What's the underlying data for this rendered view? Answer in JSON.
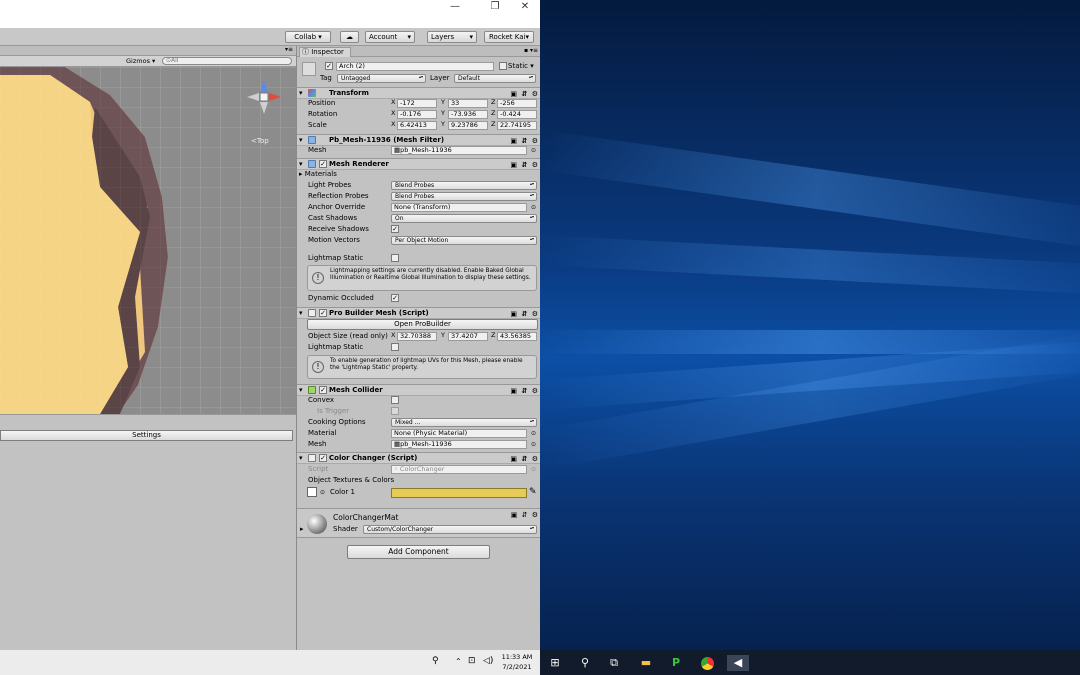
{
  "window": {
    "minimize": "—",
    "restore": "❐",
    "close": "✕"
  },
  "toolbar": {
    "collab": "Collab ▾",
    "cloud": "☁",
    "account": "Account",
    "layers": "Layers",
    "rocket": "Rocket Kai▾"
  },
  "scene": {
    "gizmos": "Gizmos ▾",
    "search_placeholder": "All",
    "orientation": "Top",
    "settings_btn": "Settings"
  },
  "inspector": {
    "tab": "Inspector",
    "object_name": "Arch (2)",
    "static_label": "Static",
    "tag_label": "Tag",
    "tag_value": "Untagged",
    "layer_label": "Layer",
    "layer_value": "Default",
    "transform": {
      "title": "Transform",
      "position": {
        "label": "Position",
        "x": "-172",
        "y": "33",
        "z": "-256"
      },
      "rotation": {
        "label": "Rotation",
        "x": "-0.176",
        "y": "-73.936",
        "z": "-0.424"
      },
      "scale": {
        "label": "Scale",
        "x": "6.42413",
        "y": "9.23786",
        "z": "22.74195"
      }
    },
    "mesh_filter": {
      "title": "Pb_Mesh-11936 (Mesh Filter)",
      "mesh_label": "Mesh",
      "mesh_value": "pb_Mesh-11936"
    },
    "mesh_renderer": {
      "title": "Mesh Renderer",
      "materials": "Materials",
      "light_probes": {
        "label": "Light Probes",
        "value": "Blend Probes"
      },
      "reflection_probes": {
        "label": "Reflection Probes",
        "value": "Blend Probes"
      },
      "anchor_override": {
        "label": "Anchor Override",
        "value": "None (Transform)"
      },
      "cast_shadows": {
        "label": "Cast Shadows",
        "value": "On"
      },
      "receive_shadows": {
        "label": "Receive Shadows"
      },
      "motion_vectors": {
        "label": "Motion Vectors",
        "value": "Per Object Motion"
      },
      "lightmap_static": {
        "label": "Lightmap Static"
      },
      "help": "Lightmapping settings are currently disabled. Enable Baked Global Illumination or Realtime Global Illumination to display these settings.",
      "dynamic_occluded": {
        "label": "Dynamic Occluded"
      }
    },
    "probuilder": {
      "title": "Pro Builder Mesh (Script)",
      "open_btn": "Open ProBuilder",
      "object_size": {
        "label": "Object Size (read only)",
        "x": "32.70388",
        "y": "37.4207",
        "z": "43.56385"
      },
      "lightmap_static": "Lightmap Static",
      "help": "To enable generation of lightmap UVs for this Mesh, please enable the 'Lightmap Static' property."
    },
    "mesh_collider": {
      "title": "Mesh Collider",
      "convex": "Convex",
      "is_trigger": "Is Trigger",
      "cooking": {
        "label": "Cooking Options",
        "value": "Mixed ..."
      },
      "material": {
        "label": "Material",
        "value": "None (Physic Material)"
      },
      "mesh": {
        "label": "Mesh",
        "value": "pb_Mesh-11936"
      }
    },
    "color_changer": {
      "title": "Color Changer (Script)",
      "script_label": "Script",
      "script_value": "ColorChanger",
      "textures_label": "Object Textures & Colors",
      "color_label": "Color 1",
      "color_value": "#e6cc55"
    },
    "material": {
      "name": "ColorChangerMat",
      "shader_label": "Shader",
      "shader_value": "Custom/ColorChanger"
    },
    "add_component": "Add Component"
  },
  "taskbar": {
    "time": "11:33 AM",
    "date": "7/2/2021"
  }
}
